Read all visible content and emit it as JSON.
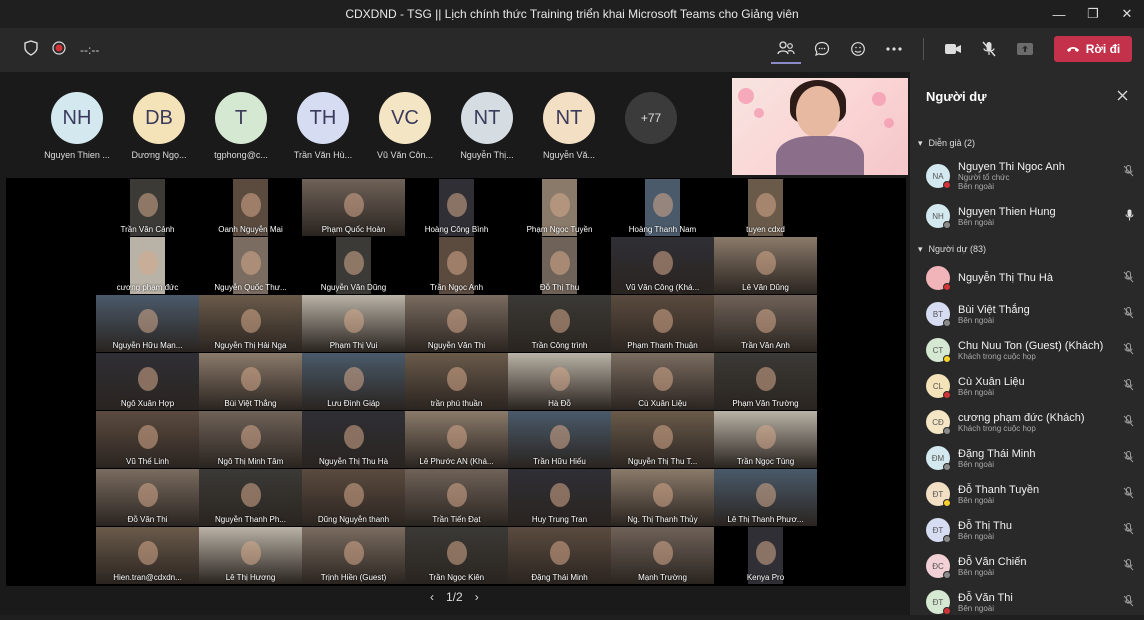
{
  "window": {
    "title": "CDXDND - TSG || Lịch chính thức Training triển khai Microsoft Teams cho Giảng viên",
    "minimize": "—",
    "maximize": "❐",
    "close": "✕"
  },
  "toolbar": {
    "timer": "--:--",
    "leave_label": "Rời đi"
  },
  "avatars": [
    {
      "initials": "NH",
      "name": "Nguyen Thien ...",
      "color": "#d3e8ef"
    },
    {
      "initials": "DB",
      "name": "Dương Ngọ...",
      "color": "#f4e2b8"
    },
    {
      "initials": "T",
      "name": "tgphong@c...",
      "color": "#d5e8d1"
    },
    {
      "initials": "TH",
      "name": "Trần Văn Hù...",
      "color": "#d6dcf1"
    },
    {
      "initials": "VC",
      "name": "Vũ Văn Côn...",
      "color": "#f4e6c4"
    },
    {
      "initials": "NT",
      "name": "Nguyễn Thị...",
      "color": "#d5dde2"
    },
    {
      "initials": "NT",
      "name": "Nguyễn Vă...",
      "color": "#f3dfc4"
    },
    {
      "initials": "+77",
      "name": "",
      "color": "#3b3b3b"
    }
  ],
  "grid_rows": [
    [
      "Trần Văn Cảnh",
      "Oanh Nguyễn Mai",
      "Phạm Quốc Hoàn",
      "Hoàng Công Bình",
      "Phạm Ngọc Tuyền",
      "Hoàng Thanh Nam",
      "tuyen cdxd"
    ],
    [
      "cương phạm đức",
      "Nguyễn Quốc Thư...",
      "Nguyễn Văn Dũng",
      "Trần Ngọc Anh",
      "Đỗ Thị Thu",
      "Vũ Văn Công (Khá...",
      "Lê Văn Dũng"
    ],
    [
      "Nguyễn Hữu Mạn...",
      "Nguyễn Thị Hải Nga",
      "Phạm Thị Vui",
      "Nguyễn Văn Thi",
      "Trần Công trình",
      "Phạm Thanh Thuận",
      "Trần Văn Anh"
    ],
    [
      "Ngô Xuân Hợp",
      "Bùi Việt Thắng",
      "Lưu Đình Giáp",
      "trần phú thuần",
      "Hà Đỗ",
      "Cù Xuân Liệu",
      "Phạm Văn Trường"
    ],
    [
      "Vũ Thế Linh",
      "Ngô Thị Minh Tâm",
      "Nguyễn Thị Thu Hà",
      "Lê Phước AN (Khá...",
      "Trần Hữu Hiếu",
      "Nguyễn Thị Thu T...",
      "Trần Ngọc Tùng"
    ],
    [
      "Đỗ Văn Thi",
      "Nguyễn Thanh Ph...",
      "Dũng Nguyễn thanh",
      "Trần Tiến Đạt",
      "Huy Trung Tran",
      "Ng. Thị Thanh Thủy",
      "Lê Thị Thanh Phươ..."
    ],
    [
      "Hien.tran@cdxdn...",
      "Lê Thị Hương",
      "Trịnh Hiền (Guest)",
      "Trần Ngọc Kiên",
      "Đặng Thái Minh",
      "Mạnh Trường",
      "Kenya Pro"
    ]
  ],
  "pager": {
    "prev": "‹",
    "label": "1/2",
    "next": "›"
  },
  "panel": {
    "title": "Người dự",
    "presenters_header": "Diễn giả (2)",
    "attendees_header": "Người dự (83)",
    "presenters": [
      {
        "initials": "NA",
        "name": "Nguyen Thi Ngoc Anh",
        "sub1": "Người tổ chức",
        "sub2": "Bên ngoài",
        "color": "#d3e8ef"
      },
      {
        "initials": "NH",
        "name": "Nguyen Thien Hung",
        "sub1": "",
        "sub2": "Bên ngoài",
        "color": "#d3e8ef"
      }
    ],
    "attendees": [
      {
        "initials": "",
        "name": "Nguyễn Thị Thu Hà",
        "sub": "",
        "color": "#f1b4b8"
      },
      {
        "initials": "BT",
        "name": "Bùi Việt Thắng",
        "sub": "Bên ngoài",
        "color": "#d6dcf1"
      },
      {
        "initials": "CT",
        "name": "Chu Nuu Ton (Guest) (Khách)",
        "sub": "Khách trong cuộc họp",
        "color": "#d5e8d1"
      },
      {
        "initials": "CL",
        "name": "Cù Xuân Liệu",
        "sub": "Bên ngoài",
        "color": "#f4e2b8"
      },
      {
        "initials": "CĐ",
        "name": "cương phạm đức (Khách)",
        "sub": "Khách trong cuộc họp",
        "color": "#f4e6c4"
      },
      {
        "initials": "ĐM",
        "name": "Đặng Thái Minh",
        "sub": "Bên ngoài",
        "color": "#d3e8ef"
      },
      {
        "initials": "ĐT",
        "name": "Đỗ Thanh Tuyền",
        "sub": "Bên ngoài",
        "color": "#f3dfc4"
      },
      {
        "initials": "ĐT",
        "name": "Đỗ Thị Thu",
        "sub": "Bên ngoài",
        "color": "#d6dcf1"
      },
      {
        "initials": "ĐC",
        "name": "Đỗ Văn Chiến",
        "sub": "Bên ngoài",
        "color": "#f1d0d6"
      },
      {
        "initials": "ĐT",
        "name": "Đỗ Văn Thi",
        "sub": "Bên ngoài",
        "color": "#d5e8d1"
      }
    ]
  },
  "colors": {
    "accent": "#6264a7",
    "leave": "#c4314b",
    "panel_bg": "#292929"
  }
}
